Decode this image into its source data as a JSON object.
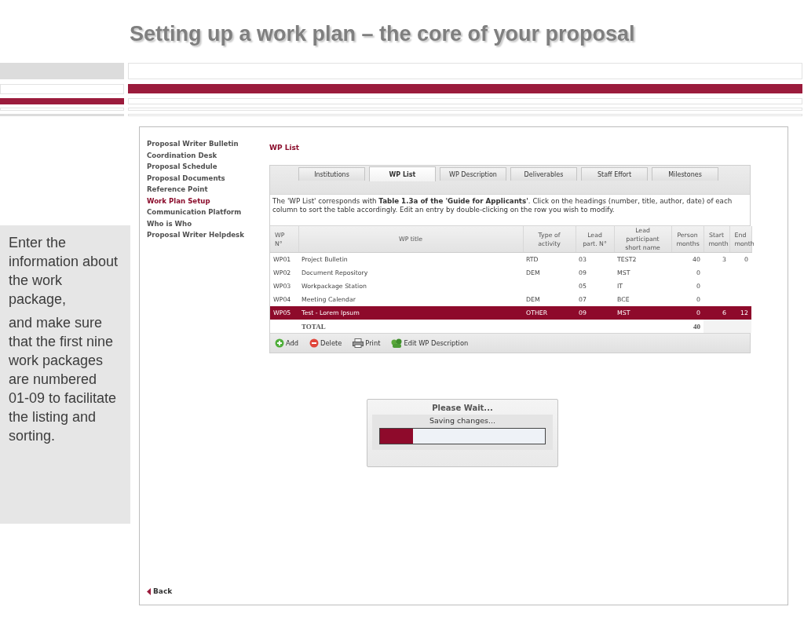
{
  "slide_title": "Setting up a work plan – the core of your proposal",
  "note": {
    "paragraphs": [
      "Enter the information about the work package,",
      "and make sure that the first nine work packages are numbered 01-09 to facilitate the listing and sorting."
    ]
  },
  "app": {
    "nav": [
      {
        "label": "Proposal Writer Bulletin",
        "selected": false
      },
      {
        "label": "Coordination Desk",
        "selected": false
      },
      {
        "label": "Proposal Schedule",
        "selected": false
      },
      {
        "label": "Proposal Documents",
        "selected": false
      },
      {
        "label": "Reference Point",
        "selected": false
      },
      {
        "label": "Work Plan Setup",
        "selected": true
      },
      {
        "label": "Communication Platform",
        "selected": false
      },
      {
        "label": "Who is Who",
        "selected": false
      },
      {
        "label": "Proposal Writer Helpdesk",
        "selected": false
      }
    ],
    "page_title": "WP List",
    "tabs": [
      {
        "label": "Institutions",
        "selected": false
      },
      {
        "label": "WP List",
        "selected": true
      },
      {
        "label": "WP Description",
        "selected": false
      },
      {
        "label": "Deliverables",
        "selected": false
      },
      {
        "label": "Staff Effort",
        "selected": false
      },
      {
        "label": "Milestones",
        "selected": false
      }
    ],
    "description": "The 'WP List' corresponds with **Table 1.3a of the 'Guide for Applicants'**. Click on the headings (number, title, author, date) of each column to sort the table accordingly. Edit an entry by double-clicking on the row you wish to modify.",
    "table": {
      "columns": [
        "WP N°",
        "WP title",
        "Type of activity",
        "Lead part. N°",
        "Lead participant short name",
        "Person months",
        "Start month",
        "End month"
      ],
      "rows": [
        {
          "wp_no": "WP01",
          "title": "Project Bulletin",
          "type": "RTD",
          "lead_no": "03",
          "lead_name": "TEST2",
          "person_months": "40",
          "start": "3",
          "end": "0",
          "selected": false
        },
        {
          "wp_no": "WP02",
          "title": "Document Repository",
          "type": "DEM",
          "lead_no": "09",
          "lead_name": "MST",
          "person_months": "0",
          "selected": false
        },
        {
          "wp_no": "WP03",
          "title": "Workpackage Station",
          "lead_no": "05",
          "lead_name": "IT",
          "person_months": "0",
          "selected": false
        },
        {
          "wp_no": "WP04",
          "title": "Meeting Calendar",
          "type": "DEM",
          "lead_no": "07",
          "lead_name": "BCE",
          "person_months": "0",
          "selected": false
        },
        {
          "wp_no": "WP05",
          "title": "Test - Lorem Ipsum",
          "type": "OTHER",
          "lead_no": "09",
          "lead_name": "MST",
          "person_months": "0",
          "start": "6",
          "end": "12",
          "selected": true
        }
      ],
      "total": {
        "label": "TOTAL",
        "person_months": "40"
      }
    },
    "toolbar": [
      {
        "kind": "add",
        "label": "Add"
      },
      {
        "kind": "delete",
        "label": "Delete"
      },
      {
        "kind": "print",
        "label": "Print"
      },
      {
        "kind": "edit",
        "label": "Edit WP Description"
      }
    ],
    "back_link": "Back"
  },
  "dialog": {
    "title": "Please Wait...",
    "message": "Saving changes...",
    "level": 0.2
  }
}
